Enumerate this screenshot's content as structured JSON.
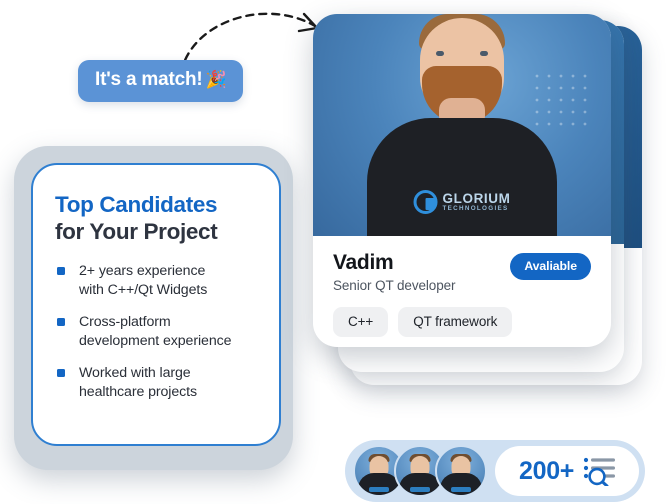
{
  "annotation": {
    "arrow_name": "dashed-curve-arrow",
    "bubble_text": "It's a match!",
    "bubble_emoji": "🎉"
  },
  "candidates_panel": {
    "title_line1": "Top Candidates",
    "title_line2": "for Your Project",
    "bullets": [
      "2+ years experience with C++/Qt Widgets",
      "Cross-platform development experience",
      "Worked with large healthcare projects"
    ],
    "bullet_lines": [
      [
        "2+ years experience",
        "with C++/Qt Widgets"
      ],
      [
        "Cross-platform",
        "development experience"
      ],
      [
        "Worked with large",
        "healthcare projects"
      ]
    ]
  },
  "candidate_card": {
    "name": "Vadim",
    "role": "Senior QT developer",
    "availability_badge": "Avaliable",
    "tags": [
      "C++",
      "QT framework"
    ],
    "photo_logo_main": "GLORIUM",
    "photo_logo_sub": "TECHNOLOGIES"
  },
  "stack": {
    "behind_cards": 2
  },
  "footer_pill": {
    "avatar_count": 3,
    "count_label": "200+",
    "icon": "list-search-icon"
  },
  "colors": {
    "accent_blue": "#1366c4",
    "bubble_blue": "#5b93d6",
    "panel_frame": "#ccd4dc",
    "chip_gray": "#eff0f2",
    "pill_blue": "#cfe0f2",
    "text_dark": "#2e3440"
  }
}
